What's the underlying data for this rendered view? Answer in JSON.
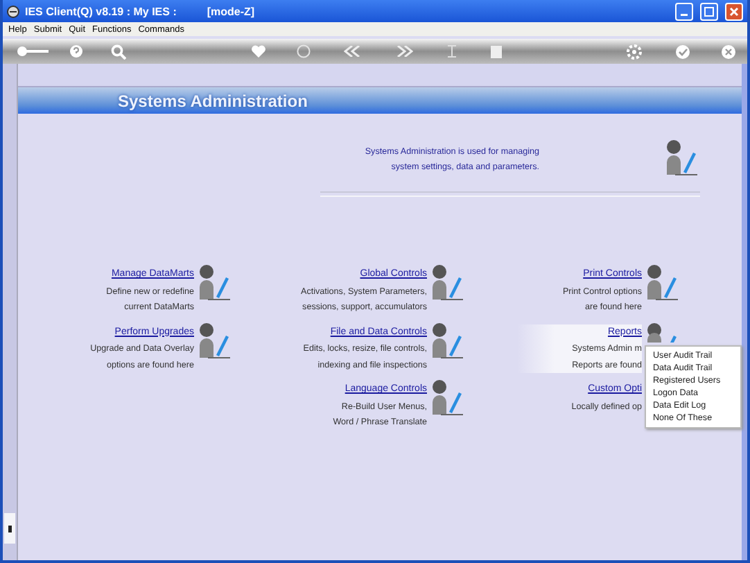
{
  "window": {
    "title": "IES Client(Q) v8.19 : My IES :",
    "mode": "[mode-Z]"
  },
  "menu_bar": [
    "Help",
    "Submit",
    "Quit",
    "Functions",
    "Commands"
  ],
  "header": {
    "title": "Systems Administration"
  },
  "intro": [
    "Systems Administration is used for managing",
    "system settings, data and parameters."
  ],
  "items": [
    {
      "title": "Manage DataMarts",
      "lines": [
        "Define new or redefine",
        "current DataMarts"
      ],
      "selected": false
    },
    {
      "title": "Global Controls",
      "lines": [
        "Activations, System Parameters,",
        "sessions, support, accumulators"
      ],
      "selected": false
    },
    {
      "title": "Print Controls",
      "lines": [
        "Print Control options",
        "are found here"
      ],
      "selected": false
    },
    {
      "title": "Perform Upgrades",
      "lines": [
        "Upgrade and Data Overlay",
        "options are found here"
      ],
      "selected": false
    },
    {
      "title": "File and Data Controls",
      "lines": [
        "Edits, locks, resize, file controls,",
        "indexing and file inspections"
      ],
      "selected": false
    },
    {
      "title": "Reports",
      "lines": [
        "Systems Admin m",
        "Reports are found"
      ],
      "selected": true
    },
    {
      "kind": "empty"
    },
    {
      "title": "Language Controls",
      "lines": [
        "Re-Build User Menus,",
        "Word / Phrase Translate"
      ],
      "selected": false
    },
    {
      "title": "Custom Opti",
      "lines": [
        "Locally defined op"
      ],
      "selected": false
    }
  ],
  "context_menu": {
    "items": [
      "User Audit Trail",
      "Data Audit Trail",
      "Registered Users",
      "Logon Data",
      "Data Edit Log",
      "None Of These"
    ]
  }
}
